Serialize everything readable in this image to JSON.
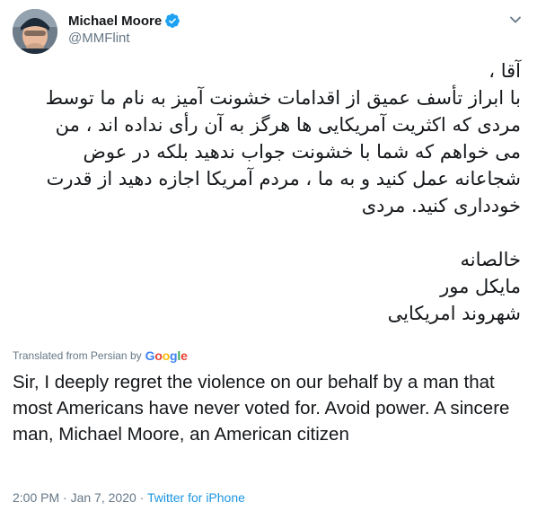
{
  "tweet": {
    "author": {
      "display_name": "Michael Moore",
      "handle": "@MMFlint",
      "verified": true
    },
    "persian_text": {
      "greeting": "آقا ،",
      "body": "با ابراز تأسف عمیق از اقدامات خشونت آمیز به نام ما توسط\nمردی که اکثریت آمریکایی ها هرگز به آن رأی نداده اند ، من\nمی خواهم که شما با خشونت جواب ندهید بلکه در عوض\nشجاعانه عمل کنید و به ما ، مردم آمریکا اجازه دهید از قدرت\nخودداری کنید. مردی",
      "signoff": "خالصانه\nمایکل مور\nشهروند امریکایی"
    },
    "translation": {
      "label": "Translated from Persian by",
      "provider": "Google",
      "text": "Sir, I deeply regret the violence on our behalf by a man that most Americans have never voted for. Avoid power. A sincere man, Michael Moore, an American citizen"
    },
    "meta": {
      "time": "2:00 PM",
      "separator1": " · ",
      "date": "Jan 7, 2020",
      "separator2": " · ",
      "source": "Twitter for iPhone"
    }
  },
  "icons": {
    "verified": "verified-badge-icon",
    "caret": "chevron-down-icon",
    "avatar": "profile-photo"
  },
  "colors": {
    "text_primary": "#14171a",
    "text_secondary": "#657786",
    "link": "#1b95e0",
    "verified": "#1da1f2"
  }
}
